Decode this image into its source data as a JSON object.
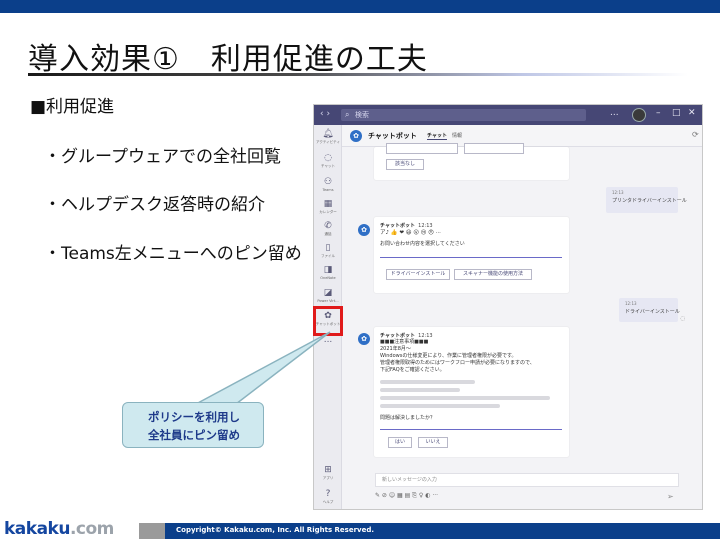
{
  "slide": {
    "title": "導入効果①　利用促進の工夫",
    "section_heading": "■利用促進",
    "bullets": [
      "・グループウェアでの全社回覧",
      "・ヘルプデスク返答時の紹介",
      "・Teams左メニューへのピン留め"
    ],
    "callout": {
      "line1": "ポリシーを利用し",
      "line2": "全社員にピン留め"
    }
  },
  "teams": {
    "search_placeholder": "検索",
    "more": "...",
    "rail": [
      {
        "label": "アクティビティ",
        "icon": "bell-icon"
      },
      {
        "label": "チャット",
        "icon": "chat-icon"
      },
      {
        "label": "Teams",
        "icon": "teams-icon"
      },
      {
        "label": "カレンダー",
        "icon": "calendar-icon"
      },
      {
        "label": "通話",
        "icon": "phone-icon"
      },
      {
        "label": "ファイル",
        "icon": "file-icon"
      },
      {
        "label": "OneNote",
        "icon": "onenote-icon"
      },
      {
        "label": "Power Virt...",
        "icon": "power-virtual-agents-icon"
      },
      {
        "label": "チャットボット",
        "icon": "chatbot-icon"
      },
      {
        "label": "...",
        "icon": "more-icon"
      },
      {
        "label": "アプリ",
        "icon": "apps-icon"
      },
      {
        "label": "ヘルプ",
        "icon": "help-icon"
      }
    ],
    "chat_header": {
      "name": "チャットボット",
      "tab_chat": "チャット",
      "tab_info": "情報"
    },
    "card1_button": "該当なし",
    "out_msg1": {
      "time": "12:13",
      "text": "プリンタドライバーインストール"
    },
    "bot_msg1": {
      "sender": "チャットボット",
      "time": "12:13",
      "reactions": "ア♪ 👍 ❤ 😆 😮 😢 😠 ···",
      "text": "お問い合わせ内容を選択してください",
      "buttons": [
        "ドライバーインストール",
        "スキャナー機能の使用方法"
      ]
    },
    "out_msg2": {
      "time": "12:13",
      "text": "ドライバーインストール"
    },
    "bot_msg2": {
      "sender": "チャットボット",
      "time": "12:13",
      "lines": [
        "■■■注意事項■■■",
        "2021年8月～",
        "Windowsの仕様変更により、作業に管理者権限が必要です。",
        "管理者権限取得のためにはワークフロー申請が必要になりますので、",
        "下記FAQをご確認ください。"
      ],
      "question": "問題は解決しましたか？",
      "buttons": [
        "はい",
        "いいえ"
      ]
    },
    "composer_placeholder": "新しいメッセージの入力",
    "compose_icons": "✎ ⊘ ☺ ▦ ▤ ⎘ ♀ ◐ ···"
  },
  "footer": {
    "logo_main": "kakaku",
    "logo_suffix": ".com",
    "copyright": "Copyright© Kakaku.com, Inc. All Rights Reserved."
  },
  "colors": {
    "brand_blue": "#0b3f8a",
    "teams_purple": "#464775",
    "highlight_red": "#e01a1a",
    "callout_fill": "#cfe9ef"
  }
}
